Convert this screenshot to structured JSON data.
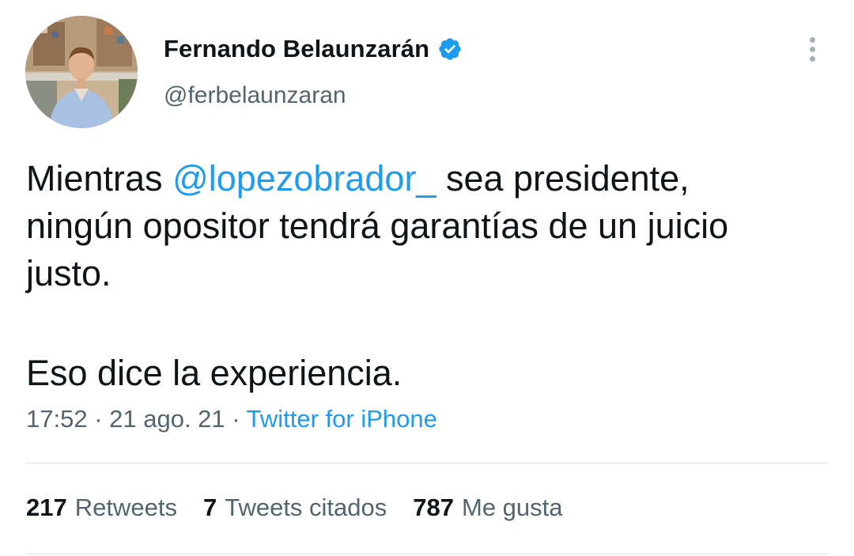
{
  "author": {
    "display_name": "Fernando Belaunzarán",
    "handle": "@ferbelaunzaran",
    "verified": true,
    "verified_color": "#1d9bf0",
    "avatar_icon": "profile-photo"
  },
  "tweet": {
    "line1_prefix": "Mientras ",
    "mention": "@lopezobrador_",
    "line1_suffix": " sea presidente,",
    "line2": "ningún opositor tendrá garantías de un juicio",
    "line3": "justo.",
    "paragraph2": "Eso dice la experiencia."
  },
  "meta": {
    "time": "17:52",
    "separator": " · ",
    "date": "21 ago. 21",
    "source": "Twitter for iPhone"
  },
  "stats": [
    {
      "count": "217",
      "label": "Retweets"
    },
    {
      "count": "7",
      "label": "Tweets citados"
    },
    {
      "count": "787",
      "label": "Me gusta"
    }
  ],
  "colors": {
    "link": "#1d9bf0",
    "secondary_text": "#536471",
    "primary_text": "#0f1419"
  }
}
